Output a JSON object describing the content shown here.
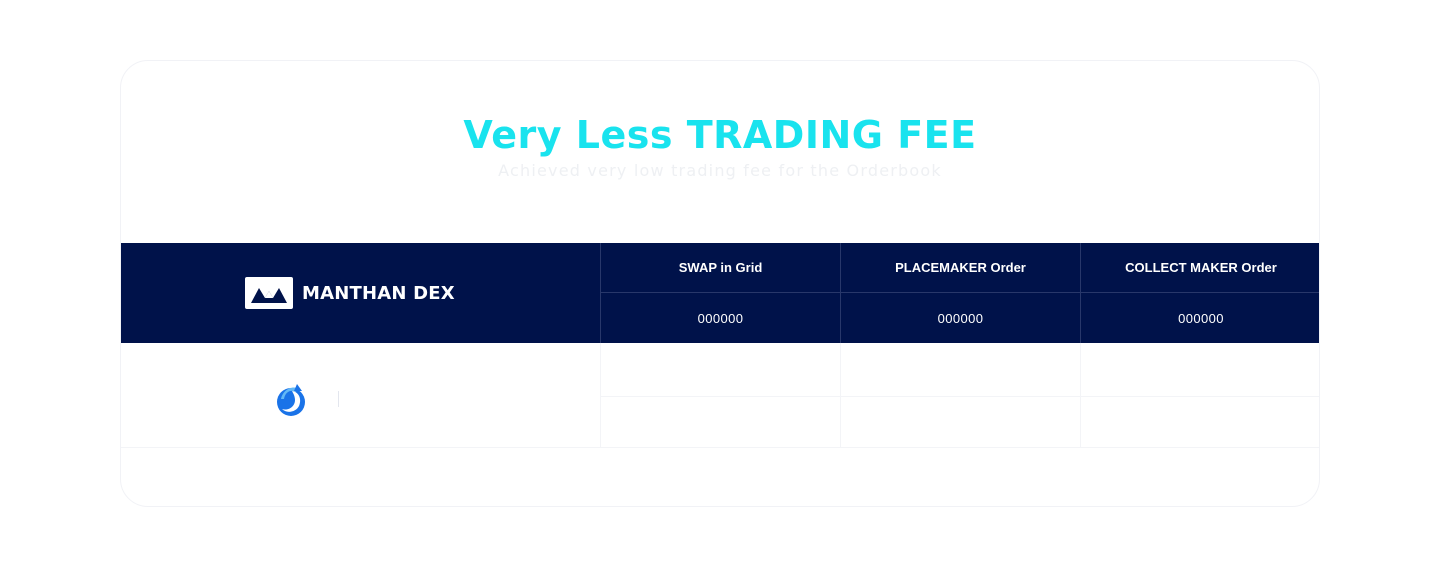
{
  "section": {
    "title": "Very Less TRADING FEE",
    "subtitle": "Achieved very low trading fee for the Orderbook"
  },
  "table": {
    "brand": {
      "name": "MANTHAN DEX",
      "icon": "manthan-dex-logo-icon"
    },
    "columns": [
      {
        "label": "SWAP in Grid",
        "value": "000000"
      },
      {
        "label": "PLACEMAKER Order",
        "value": "000000"
      },
      {
        "label": "COLLECT MAKER Order",
        "value": "000000"
      }
    ],
    "comparison_row": {
      "icon": "competitor-logo-icon",
      "values": [
        "",
        "",
        ""
      ]
    }
  },
  "colors": {
    "accent": "#19e3ee",
    "header_bg": "#00124a",
    "text_light": "#ffffff"
  }
}
